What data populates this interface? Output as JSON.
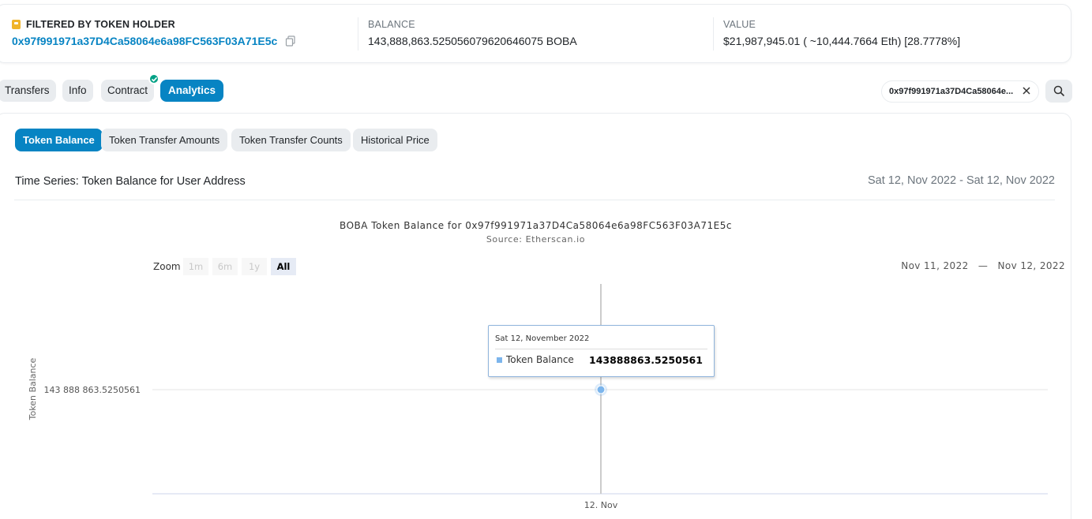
{
  "summary": {
    "holder_label": "FILTERED BY TOKEN HOLDER",
    "holder_address": "0x97f991971a37D4Ca58064e6a98FC563F03A71E5c",
    "balance_label": "BALANCE",
    "balance_value": "143,888,863.525056079620646075 BOBA",
    "value_label": "VALUE",
    "value_value": "$21,987,945.01 ( ~10,444.7664 Eth) [28.7778%]"
  },
  "tabs": [
    {
      "label": "Transfers"
    },
    {
      "label": "Info"
    },
    {
      "label": "Contract"
    },
    {
      "label": "Analytics",
      "active": true
    }
  ],
  "filter": {
    "address": "0x97f991971a37D4Ca58064e..."
  },
  "subtabs": [
    {
      "label": "Token Balance",
      "active": true
    },
    {
      "label": "Token Transfer Amounts"
    },
    {
      "label": "Token Transfer Counts"
    },
    {
      "label": "Historical Price"
    }
  ],
  "timeseries": {
    "title": "Time Series: Token Balance for User Address",
    "range": "Sat 12, Nov 2022 - Sat 12, Nov 2022"
  },
  "zoom": {
    "label": "Zoom",
    "options": [
      "1m",
      "6m",
      "1y",
      "All"
    ],
    "selected": "All",
    "from": "Nov 11, 2022",
    "dash": "—",
    "to": "Nov 12, 2022"
  },
  "tooltip": {
    "date": "Sat 12, November 2022",
    "series": "Token Balance",
    "value": "143888863.5250561"
  },
  "colors": {
    "accent": "#0784c3",
    "series": "#7cb5ec",
    "verified": "#00a186"
  },
  "chart_data": {
    "type": "line",
    "title": "BOBA Token Balance for 0x97f991971a37D4Ca58064e6a98FC563F03A71E5c",
    "subtitle": "Source: Etherscan.io",
    "ylabel": "Token Balance",
    "xlabel": "",
    "x": [
      "12. Nov"
    ],
    "series": [
      {
        "name": "Token Balance",
        "values": [
          143888863.5250561
        ]
      }
    ],
    "y_tick_labels": [
      "143 888 863.5250561"
    ],
    "x_tick_labels": [
      "12. Nov"
    ],
    "grid": true,
    "legend": "none"
  }
}
